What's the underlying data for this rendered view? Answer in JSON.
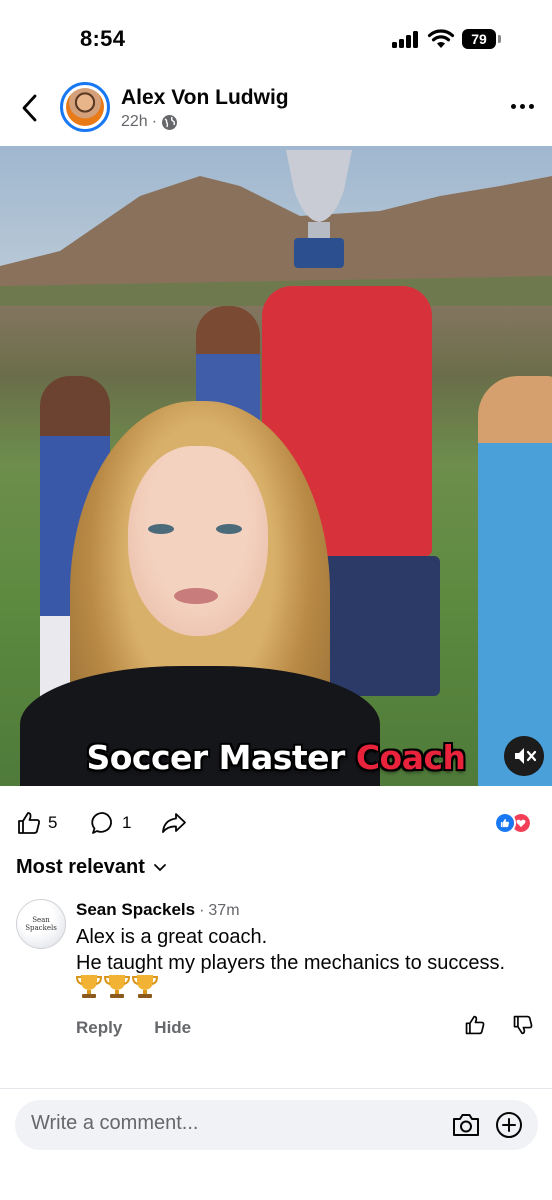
{
  "status_bar": {
    "time": "8:54",
    "battery": "79"
  },
  "post": {
    "author": "Alex Von Ludwig",
    "age": "22h",
    "privacy_separator": "·",
    "privacy_icon": "globe-icon",
    "caption_main": "Soccer Master",
    "caption_accent": "Coach",
    "caption_accent_color": "#e8233b"
  },
  "actions": {
    "like_count": "5",
    "comment_count": "1",
    "reaction_types": [
      "like",
      "love"
    ],
    "reaction_colors": {
      "like": "#1877f2",
      "love": "#f33e58"
    }
  },
  "sort": {
    "label": "Most relevant"
  },
  "comment": {
    "author": "Sean Spackels",
    "time_separator": "·",
    "time": "37m",
    "line1": "Alex is a great coach.",
    "line2": "He taught my players the mechanics to success.",
    "emojis": [
      "trophy-icon",
      "trophy-icon",
      "trophy-icon"
    ],
    "avatar_text": "Sean Spackels",
    "reply_label": "Reply",
    "hide_label": "Hide"
  },
  "composer": {
    "placeholder": "Write a comment..."
  },
  "colors": {
    "brand_blue": "#1877f2",
    "secondary_text": "#65676b",
    "input_bg": "#f0f2f5"
  }
}
